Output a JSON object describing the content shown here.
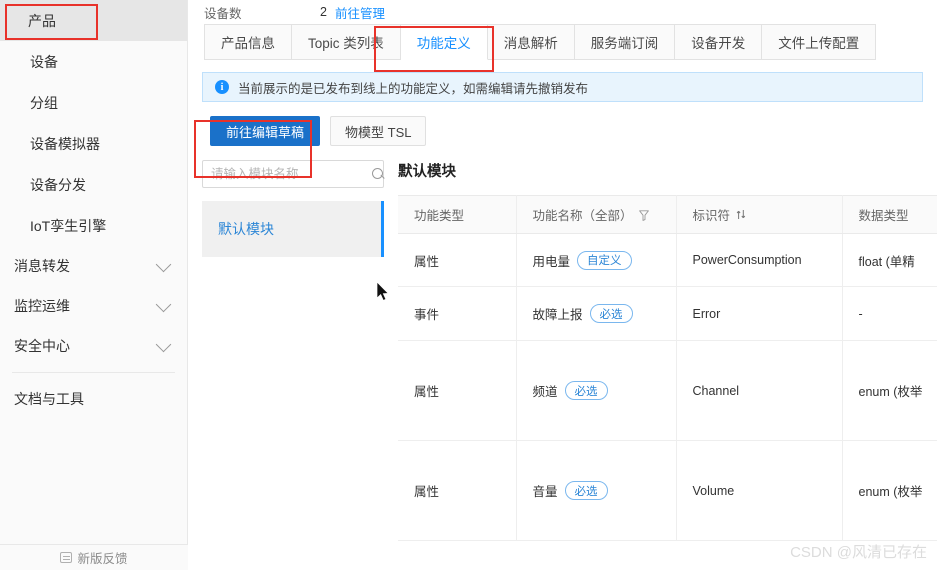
{
  "sidebar": {
    "items": [
      {
        "label": "产品",
        "active": true
      },
      {
        "label": "设备",
        "active": false
      },
      {
        "label": "分组",
        "active": false
      },
      {
        "label": "设备模拟器",
        "active": false
      },
      {
        "label": "设备分发",
        "active": false
      },
      {
        "label": "IoT孪生引擎",
        "active": false
      }
    ],
    "groups": [
      {
        "label": "消息转发"
      },
      {
        "label": "监控运维"
      },
      {
        "label": "安全中心"
      }
    ],
    "docs_label": "文档与工具",
    "feedback_label": "新版反馈"
  },
  "header": {
    "device_count_label": "设备数",
    "device_count_value": "2",
    "manage_link": "前往管理"
  },
  "tabs": [
    {
      "label": "产品信息",
      "active": false
    },
    {
      "label": "Topic 类列表",
      "active": false
    },
    {
      "label": "功能定义",
      "active": true
    },
    {
      "label": "消息解析",
      "active": false
    },
    {
      "label": "服务端订阅",
      "active": false
    },
    {
      "label": "设备开发",
      "active": false
    },
    {
      "label": "文件上传配置",
      "active": false
    }
  ],
  "notice": {
    "text": "当前展示的是已发布到线上的功能定义，如需编辑请先撤销发布"
  },
  "actions": {
    "primary_label": "前往编辑草稿",
    "secondary_label": "物模型 TSL"
  },
  "module_panel": {
    "search_placeholder": "请输入模块名称",
    "search_value": "",
    "items": [
      {
        "label": "默认模块",
        "active": true
      }
    ]
  },
  "table": {
    "title": "默认模块",
    "columns": [
      {
        "label": "功能类型",
        "icon": null
      },
      {
        "label": "功能名称（全部）",
        "icon": "filter-icon"
      },
      {
        "label": "标识符",
        "icon": "sort-icon"
      },
      {
        "label": "数据类型",
        "icon": null
      }
    ],
    "rows": [
      {
        "type": "属性",
        "name": "用电量",
        "tag": "自定义",
        "identifier": "PowerConsumption",
        "datatype": "float (单精"
      },
      {
        "type": "事件",
        "name": "故障上报",
        "tag": "必选",
        "identifier": "Error",
        "datatype": "-"
      },
      {
        "type": "属性",
        "name": "频道",
        "tag": "必选",
        "identifier": "Channel",
        "datatype": "enum (枚举"
      },
      {
        "type": "属性",
        "name": "音量",
        "tag": "必选",
        "identifier": "Volume",
        "datatype": "enum (枚举"
      }
    ]
  },
  "watermark": "CSDN @风清已存在",
  "colors": {
    "accent": "#1890ff",
    "primary_button": "#1a71c9",
    "annotation": "#e8322a",
    "notice_bg": "#e8f4fd",
    "sidebar_bg": "#fafafa"
  }
}
